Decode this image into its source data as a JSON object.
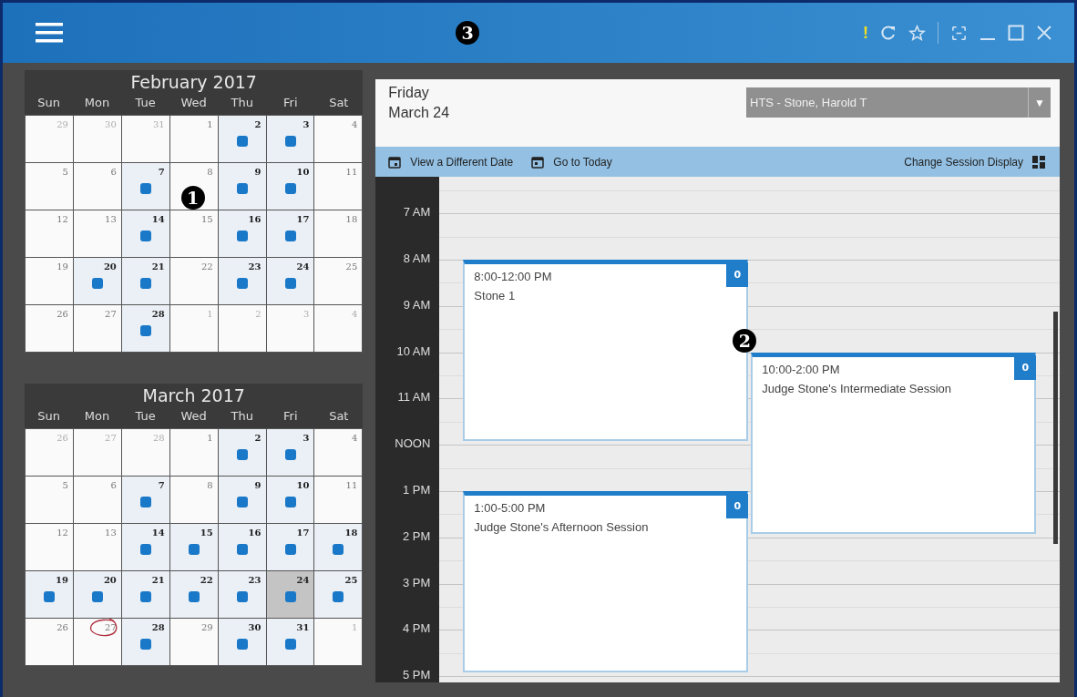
{
  "title_bar": {
    "callout": "3",
    "alert": "!"
  },
  "calendars": [
    {
      "title": "February 2017",
      "weekdays": [
        "Sun",
        "Mon",
        "Tue",
        "Wed",
        "Thu",
        "Fri",
        "Sat"
      ],
      "weeks": [
        [
          {
            "day": "29",
            "other_month": true,
            "event": false,
            "selected": false,
            "today": false
          },
          {
            "day": "30",
            "other_month": true,
            "event": false,
            "selected": false,
            "today": false
          },
          {
            "day": "31",
            "other_month": true,
            "event": false,
            "selected": false,
            "today": false
          },
          {
            "day": "1",
            "other_month": false,
            "event": false,
            "selected": false,
            "today": false
          },
          {
            "day": "2",
            "other_month": false,
            "event": true,
            "selected": false,
            "today": false
          },
          {
            "day": "3",
            "other_month": false,
            "event": true,
            "selected": false,
            "today": false
          },
          {
            "day": "4",
            "other_month": false,
            "event": false,
            "selected": false,
            "today": false
          }
        ],
        [
          {
            "day": "5",
            "other_month": false,
            "event": false,
            "selected": false,
            "today": false
          },
          {
            "day": "6",
            "other_month": false,
            "event": false,
            "selected": false,
            "today": false
          },
          {
            "day": "7",
            "other_month": false,
            "event": true,
            "selected": false,
            "today": false
          },
          {
            "day": "8",
            "other_month": false,
            "event": false,
            "selected": false,
            "today": false,
            "callout": "1"
          },
          {
            "day": "9",
            "other_month": false,
            "event": true,
            "selected": false,
            "today": false
          },
          {
            "day": "10",
            "other_month": false,
            "event": true,
            "selected": false,
            "today": false
          },
          {
            "day": "11",
            "other_month": false,
            "event": false,
            "selected": false,
            "today": false
          }
        ],
        [
          {
            "day": "12",
            "other_month": false,
            "event": false,
            "selected": false,
            "today": false
          },
          {
            "day": "13",
            "other_month": false,
            "event": false,
            "selected": false,
            "today": false
          },
          {
            "day": "14",
            "other_month": false,
            "event": true,
            "selected": false,
            "today": false
          },
          {
            "day": "15",
            "other_month": false,
            "event": false,
            "selected": false,
            "today": false
          },
          {
            "day": "16",
            "other_month": false,
            "event": true,
            "selected": false,
            "today": false
          },
          {
            "day": "17",
            "other_month": false,
            "event": true,
            "selected": false,
            "today": false
          },
          {
            "day": "18",
            "other_month": false,
            "event": false,
            "selected": false,
            "today": false
          }
        ],
        [
          {
            "day": "19",
            "other_month": false,
            "event": false,
            "selected": false,
            "today": false
          },
          {
            "day": "20",
            "other_month": false,
            "event": true,
            "selected": false,
            "today": false
          },
          {
            "day": "21",
            "other_month": false,
            "event": true,
            "selected": false,
            "today": false
          },
          {
            "day": "22",
            "other_month": false,
            "event": false,
            "selected": false,
            "today": false
          },
          {
            "day": "23",
            "other_month": false,
            "event": true,
            "selected": false,
            "today": false
          },
          {
            "day": "24",
            "other_month": false,
            "event": true,
            "selected": false,
            "today": false
          },
          {
            "day": "25",
            "other_month": false,
            "event": false,
            "selected": false,
            "today": false
          }
        ],
        [
          {
            "day": "26",
            "other_month": false,
            "event": false,
            "selected": false,
            "today": false
          },
          {
            "day": "27",
            "other_month": false,
            "event": false,
            "selected": false,
            "today": false
          },
          {
            "day": "28",
            "other_month": false,
            "event": true,
            "selected": false,
            "today": false
          },
          {
            "day": "1",
            "other_month": true,
            "event": false,
            "selected": false,
            "today": false
          },
          {
            "day": "2",
            "other_month": true,
            "event": false,
            "selected": false,
            "today": false
          },
          {
            "day": "3",
            "other_month": true,
            "event": false,
            "selected": false,
            "today": false
          },
          {
            "day": "4",
            "other_month": true,
            "event": false,
            "selected": false,
            "today": false
          }
        ]
      ]
    },
    {
      "title": "March 2017",
      "weekdays": [
        "Sun",
        "Mon",
        "Tue",
        "Wed",
        "Thu",
        "Fri",
        "Sat"
      ],
      "weeks": [
        [
          {
            "day": "26",
            "other_month": true,
            "event": false,
            "selected": false,
            "today": false
          },
          {
            "day": "27",
            "other_month": true,
            "event": false,
            "selected": false,
            "today": false
          },
          {
            "day": "28",
            "other_month": true,
            "event": false,
            "selected": false,
            "today": false
          },
          {
            "day": "1",
            "other_month": false,
            "event": false,
            "selected": false,
            "today": false
          },
          {
            "day": "2",
            "other_month": false,
            "event": true,
            "selected": false,
            "today": false
          },
          {
            "day": "3",
            "other_month": false,
            "event": true,
            "selected": false,
            "today": false
          },
          {
            "day": "4",
            "other_month": false,
            "event": false,
            "selected": false,
            "today": false
          }
        ],
        [
          {
            "day": "5",
            "other_month": false,
            "event": false,
            "selected": false,
            "today": false
          },
          {
            "day": "6",
            "other_month": false,
            "event": false,
            "selected": false,
            "today": false
          },
          {
            "day": "7",
            "other_month": false,
            "event": true,
            "selected": false,
            "today": false
          },
          {
            "day": "8",
            "other_month": false,
            "event": false,
            "selected": false,
            "today": false
          },
          {
            "day": "9",
            "other_month": false,
            "event": true,
            "selected": false,
            "today": false
          },
          {
            "day": "10",
            "other_month": false,
            "event": true,
            "selected": false,
            "today": false
          },
          {
            "day": "11",
            "other_month": false,
            "event": false,
            "selected": false,
            "today": false
          }
        ],
        [
          {
            "day": "12",
            "other_month": false,
            "event": false,
            "selected": false,
            "today": false
          },
          {
            "day": "13",
            "other_month": false,
            "event": false,
            "selected": false,
            "today": false
          },
          {
            "day": "14",
            "other_month": false,
            "event": true,
            "selected": false,
            "today": false
          },
          {
            "day": "15",
            "other_month": false,
            "event": true,
            "selected": false,
            "today": false
          },
          {
            "day": "16",
            "other_month": false,
            "event": true,
            "selected": false,
            "today": false
          },
          {
            "day": "17",
            "other_month": false,
            "event": true,
            "selected": false,
            "today": false
          },
          {
            "day": "18",
            "other_month": false,
            "event": true,
            "selected": false,
            "today": false
          }
        ],
        [
          {
            "day": "19",
            "other_month": false,
            "event": true,
            "selected": false,
            "today": false
          },
          {
            "day": "20",
            "other_month": false,
            "event": true,
            "selected": false,
            "today": false
          },
          {
            "day": "21",
            "other_month": false,
            "event": true,
            "selected": false,
            "today": false
          },
          {
            "day": "22",
            "other_month": false,
            "event": true,
            "selected": false,
            "today": false
          },
          {
            "day": "23",
            "other_month": false,
            "event": true,
            "selected": false,
            "today": false
          },
          {
            "day": "24",
            "other_month": false,
            "event": true,
            "selected": true,
            "today": false
          },
          {
            "day": "25",
            "other_month": false,
            "event": true,
            "selected": false,
            "today": false
          }
        ],
        [
          {
            "day": "26",
            "other_month": false,
            "event": false,
            "selected": false,
            "today": false
          },
          {
            "day": "27",
            "other_month": false,
            "event": false,
            "selected": false,
            "today": true
          },
          {
            "day": "28",
            "other_month": false,
            "event": true,
            "selected": false,
            "today": false
          },
          {
            "day": "29",
            "other_month": false,
            "event": false,
            "selected": false,
            "today": false
          },
          {
            "day": "30",
            "other_month": false,
            "event": true,
            "selected": false,
            "today": false
          },
          {
            "day": "31",
            "other_month": false,
            "event": true,
            "selected": false,
            "today": false
          },
          {
            "day": "1",
            "other_month": true,
            "event": false,
            "selected": false,
            "today": false
          }
        ]
      ]
    }
  ],
  "day_view": {
    "weekday": "Friday",
    "date": "March 24",
    "judge_select": {
      "value": "HTS - Stone, Harold T",
      "arrow": "▼"
    },
    "toolbar": {
      "view_date": "View a Different Date",
      "go_today": "Go to Today",
      "change_display": "Change Session Display"
    },
    "hours": [
      "7 AM",
      "8 AM",
      "9 AM",
      "10 AM",
      "11 AM",
      "NOON",
      "1 PM",
      "2 PM",
      "3 PM",
      "4 PM",
      "5 PM"
    ],
    "callout": "2",
    "sessions": [
      {
        "time": "8:00-12:00 PM",
        "title": "Stone 1",
        "count": "0"
      },
      {
        "time": "10:00-2:00 PM",
        "title": "Judge Stone's Intermediate Session",
        "count": "0"
      },
      {
        "time": "1:00-5:00 PM",
        "title": "Judge Stone's Afternoon Session",
        "count": "0"
      }
    ]
  }
}
